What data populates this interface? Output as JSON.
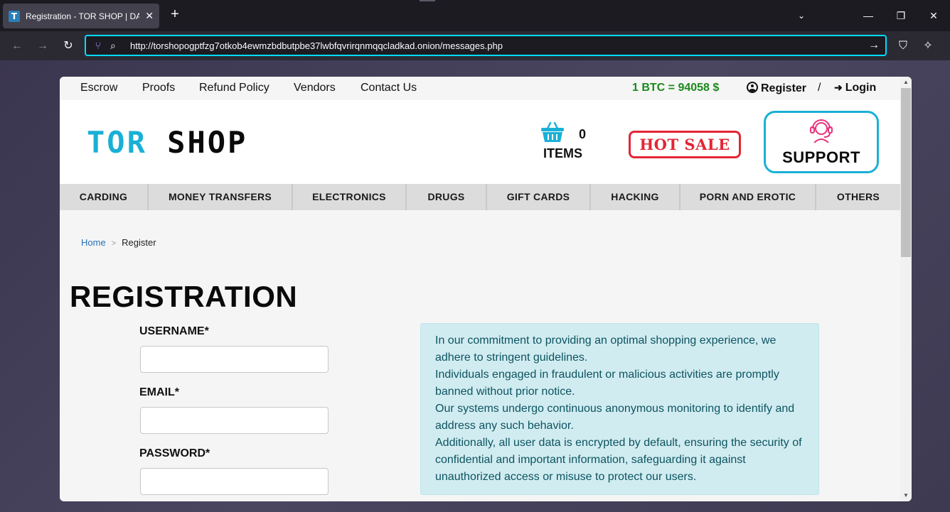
{
  "browser": {
    "tab_title": "Registration - TOR SHOP | DARK",
    "favicon_letter": "T",
    "url": "http://torshopogptfzg7otkob4ewmzbdbutpbe37lwbfqvrirqnmqqcladkad.onion/messages.php"
  },
  "topbar": {
    "links": [
      "Escrow",
      "Proofs",
      "Refund Policy",
      "Vendors",
      "Contact Us"
    ],
    "btc_rate": "1 BTC = 94058 $",
    "register": "Register",
    "separator": "/",
    "login": "Login"
  },
  "header": {
    "logo_part1": "TOR",
    "logo_part2": "SHOP",
    "cart_count": "0",
    "cart_label": "ITEMS",
    "hot_sale": "HOT SALE",
    "support": "SUPPORT"
  },
  "categories": [
    "CARDING",
    "MONEY TRANSFERS",
    "ELECTRONICS",
    "DRUGS",
    "GIFT CARDS",
    "HACKING",
    "PORN AND EROTIC",
    "OTHERS"
  ],
  "breadcrumb": {
    "home": "Home",
    "separator": ">",
    "current": "Register"
  },
  "form": {
    "title": "REGISTRATION",
    "username_label": "USERNAME*",
    "email_label": "EMAIL*",
    "password_label": "PASSWORD*"
  },
  "notice": {
    "lines": [
      "In our commitment to providing an optimal shopping experience, we adhere to stringent guidelines.",
      "Individuals engaged in fraudulent or malicious activities are promptly banned without prior notice.",
      "Our systems undergo continuous anonymous monitoring to identify and address any such behavior.",
      "Additionally, all user data is encrypted by default, ensuring the security of confidential and important information, safeguarding it against unauthorized access or misuse to protect our users."
    ]
  },
  "colors": {
    "accent": "#1ab0d6",
    "btc_green": "#1a8a1a",
    "hot_sale_red": "#e32636",
    "notice_bg": "#d1ecf1"
  }
}
